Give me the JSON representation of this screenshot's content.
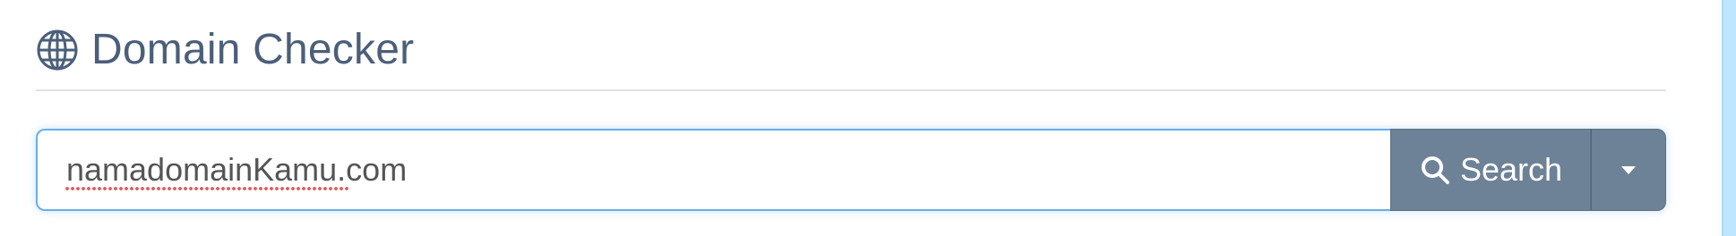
{
  "header": {
    "icon": "globe-icon",
    "title": "Domain Checker"
  },
  "search": {
    "value": "namadomainKamu.com",
    "button_icon": "search-icon",
    "button_label": "Search",
    "dropdown_icon": "caret-down-icon"
  },
  "colors": {
    "title": "#4b5f79",
    "button_bg": "#6d8296",
    "input_focus_border": "#66afe9",
    "right_strip": "#bfe6ff"
  }
}
